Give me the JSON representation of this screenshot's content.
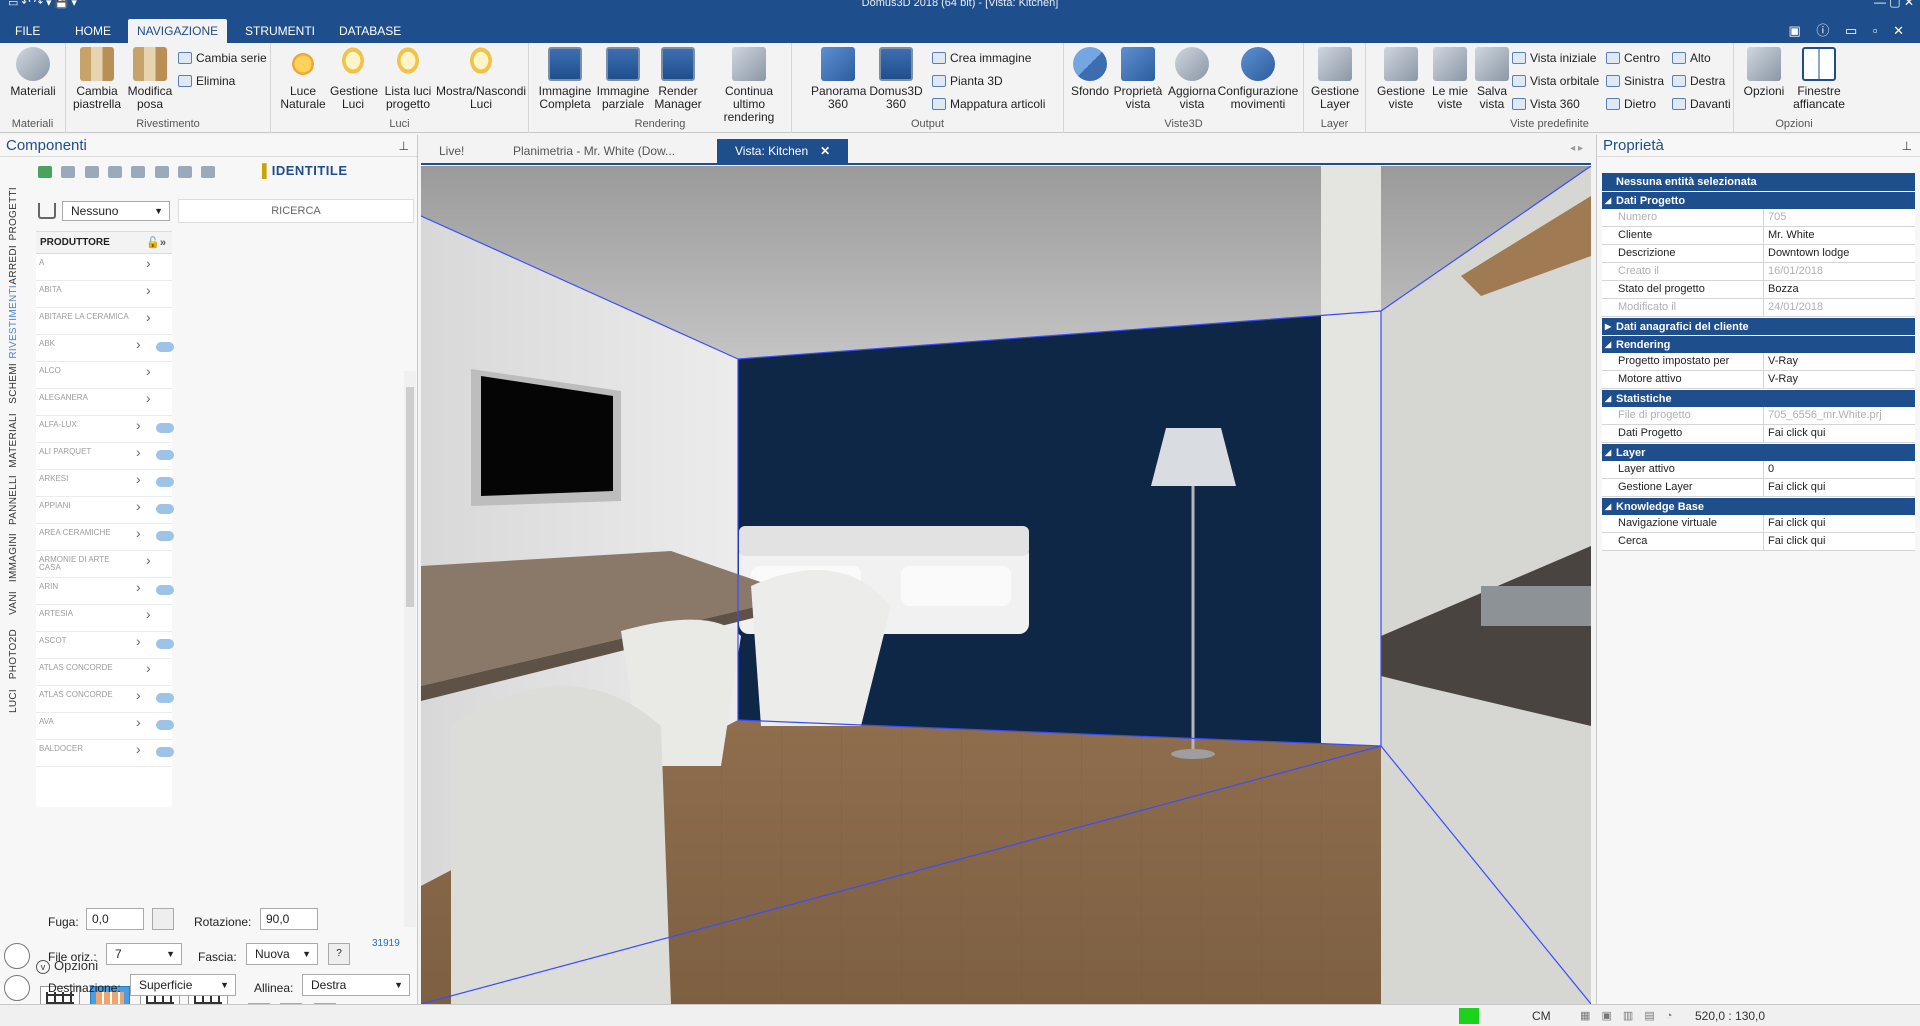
{
  "app": {
    "title": "Domus3D 2018 (64 bit) - [Vista: Kitchen]",
    "quick_access": "▭  ↶ ↷  ▾  💾 ▾",
    "window_controls": "—   ▢   ✕"
  },
  "tabs": [
    {
      "label": "FILE"
    },
    {
      "label": "HOME"
    },
    {
      "label": "NAVIGAZIONE"
    },
    {
      "label": "STRUMENTI"
    },
    {
      "label": "DATABASE"
    }
  ],
  "tab_right_icons": "▣ ⓘ ▭ ▫ ✕",
  "ribbon": {
    "materiali": {
      "group": "Materiali",
      "btn": "Materiali"
    },
    "rivestimento": {
      "group": "Rivestimento",
      "cambia_piastrella": "Cambia piastrella",
      "modifica_posa": "Modifica posa",
      "cambia_serie": "Cambia serie",
      "elimina": "Elimina"
    },
    "luci": {
      "group": "Luci",
      "luce_naturale": "Luce Naturale",
      "gestione_luci": "Gestione Luci",
      "lista_luci": "Lista luci progetto",
      "mostra_nascondi": "Mostra/Nascondi Luci"
    },
    "rendering": {
      "group": "Rendering",
      "immagine_completa": "Immagine Completa",
      "immagine_parziale": "Immagine parziale",
      "render_manager": "Render Manager",
      "continua": "Continua ultimo rendering"
    },
    "output": {
      "group": "Output",
      "panorama": "Panorama 360",
      "domus3d360": "Domus3D 360",
      "crea_immagine": "Crea immagine",
      "pianta3d": "Pianta 3D",
      "mappatura": "Mappatura articoli"
    },
    "viste3d": {
      "group": "Viste3D",
      "sfondo": "Sfondo",
      "proprieta_vista": "Proprietà vista",
      "aggiorna_vista": "Aggiorna vista",
      "configurazione": "Configurazione movimenti"
    },
    "layer": {
      "group": "Layer",
      "gestione_layer": "Gestione Layer"
    },
    "viste_predefinite": {
      "group": "Viste predefinite",
      "gestione_viste": "Gestione viste",
      "le_mie_viste": "Le mie viste",
      "salva_vista": "Salva vista",
      "vista_iniziale": "Vista iniziale",
      "vista_orbitale": "Vista orbitale",
      "vista_360": "Vista 360",
      "centro": "Centro",
      "sinistra": "Sinistra",
      "dietro": "Dietro",
      "alto": "Alto",
      "destra": "Destra",
      "davanti": "Davanti"
    },
    "opzioni": {
      "group": "Opzioni",
      "opzioni": "Opzioni",
      "finestre": "Finestre affiancate"
    }
  },
  "left_panel": {
    "title": "Componenti",
    "pin": "⊥",
    "identitile": "IDENTITILE",
    "vtabs": [
      "PROGETTI",
      "ARREDI",
      "RIVESTIMENTI",
      "SCHEMI",
      "MATERIALI",
      "PANNELLI",
      "IMMAGINI",
      "VANI",
      "PHOTO2D",
      "LUCI"
    ],
    "filter_value": "Nessuno",
    "search_placeholder": "RICERCA",
    "producer_header": "PRODUTTORE",
    "producers": [
      {
        "name": "A",
        "dl": false
      },
      {
        "name": "ABITA",
        "dl": false
      },
      {
        "name": "ABITARE LA CERAMICA",
        "dl": false
      },
      {
        "name": "ABK",
        "dl": true
      },
      {
        "name": "ALCO",
        "dl": false
      },
      {
        "name": "ALEGANERA",
        "dl": false
      },
      {
        "name": "ALFA-LUX",
        "dl": true
      },
      {
        "name": "ALI PARQUET",
        "dl": true
      },
      {
        "name": "ARKESI",
        "dl": true
      },
      {
        "name": "APPIANI",
        "dl": true
      },
      {
        "name": "AREA CERAMICHE",
        "dl": true
      },
      {
        "name": "ARMONIE DI ARTE CASA",
        "dl": false
      },
      {
        "name": "ARIN",
        "dl": true
      },
      {
        "name": "ARTESIA",
        "dl": false
      },
      {
        "name": "ASCOT",
        "dl": true
      },
      {
        "name": "ATLAS CONCORDE",
        "dl": false
      },
      {
        "name": "ATLAS CONCORDE",
        "dl": true
      },
      {
        "name": "AVA",
        "dl": true
      },
      {
        "name": "BALDOCER",
        "dl": true
      }
    ],
    "count": "31919",
    "options_label": "Opzioni",
    "fuga_label": "Fuga:",
    "fuga_value": "0,0",
    "rotazione_label": "Rotazione:",
    "rotazione_value": "90,0",
    "file_oriz_label": "File oriz.:",
    "file_oriz_value": "7",
    "fascia_label": "Fascia:",
    "fascia_value": "Nuova",
    "help": "?",
    "destinazione_label": "Destinazione:",
    "destinazione_value": "Superficie",
    "allinea_label": "Allinea:",
    "allinea_value": "Destra"
  },
  "doc_tabs": [
    {
      "label": "Live!"
    },
    {
      "label": "Planimetria - Mr. White (Dow..."
    },
    {
      "label": "Vista: Kitchen",
      "close": "✕"
    }
  ],
  "doc_tab_arrows": "◂ ▸",
  "right_panel": {
    "title": "Proprietà",
    "pin": "⊥",
    "selection": "Nessuna entità selezionata",
    "sections": [
      {
        "title": "Dati Progetto",
        "open": true,
        "rows": [
          {
            "k": "Numero",
            "v": "705",
            "dis": true
          },
          {
            "k": "Cliente",
            "v": "Mr. White"
          },
          {
            "k": "Descrizione",
            "v": "Downtown lodge"
          },
          {
            "k": "Creato il",
            "v": "16/01/2018",
            "dis": true
          },
          {
            "k": "Stato del progetto",
            "v": "Bozza"
          },
          {
            "k": "Modificato il",
            "v": "24/01/2018",
            "dis": true
          }
        ]
      },
      {
        "title": "Dati anagrafici del cliente",
        "open": false,
        "rows": []
      },
      {
        "title": "Rendering",
        "open": true,
        "rows": [
          {
            "k": "Progetto impostato per",
            "v": "V-Ray"
          },
          {
            "k": "Motore attivo",
            "v": "V-Ray"
          }
        ]
      },
      {
        "title": "Statistiche",
        "open": true,
        "rows": [
          {
            "k": "File di progetto",
            "v": "705_6556_mr.White.prj",
            "dis": true
          },
          {
            "k": "Dati Progetto",
            "v": "Fai click qui"
          }
        ]
      },
      {
        "title": "Layer",
        "open": true,
        "rows": [
          {
            "k": "Layer attivo",
            "v": "0"
          },
          {
            "k": "Gestione Layer",
            "v": "Fai click qui"
          }
        ]
      },
      {
        "title": "Knowledge Base",
        "open": true,
        "rows": [
          {
            "k": "Navigazione virtuale",
            "v": "Fai click qui"
          },
          {
            "k": "Cerca",
            "v": "Fai click qui"
          }
        ]
      }
    ]
  },
  "status": {
    "unit": "CM",
    "icons": "▦ ▣ ▥ ▤ ◔",
    "coords": "520,0 : 130,0"
  },
  "colors": {
    "accent": "#1f4e8c",
    "wall_navy": "#0f2747",
    "floor_wood": "#9b7a57",
    "status_green": "#1bd31b"
  }
}
